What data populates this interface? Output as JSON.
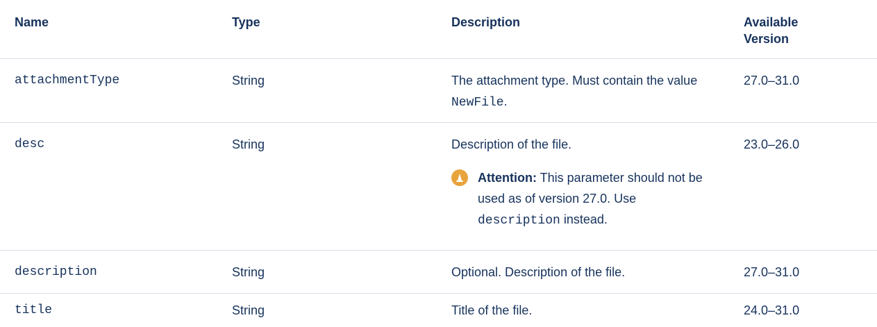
{
  "table": {
    "headers": {
      "name": "Name",
      "type": "Type",
      "description": "Description",
      "version_line1": "Available",
      "version_line2": "Version"
    },
    "rows": [
      {
        "name": "attachmentType",
        "type": "String",
        "description_pre": "The attachment type. Must contain the value ",
        "description_code": "NewFile",
        "description_post": ".",
        "version": "27.0–31.0"
      },
      {
        "name": "desc",
        "type": "String",
        "description": "Description of the file.",
        "attention": {
          "label": "Attention:",
          "text_pre": " This parameter should not be used as of version 27.0. Use ",
          "code": "description",
          "text_post": " instead."
        },
        "version": "23.0–26.0"
      },
      {
        "name": "description",
        "type": "String",
        "description": "Optional. Description of the file.",
        "version": "27.0–31.0"
      },
      {
        "name": "title",
        "type": "String",
        "description": "Title of the file.",
        "version": "24.0–31.0"
      }
    ]
  },
  "colors": {
    "text": "#16325c",
    "divider": "#d8dde6",
    "attention_icon": "#e8a43c"
  },
  "icons": {
    "attention": "attention-cone-icon"
  }
}
